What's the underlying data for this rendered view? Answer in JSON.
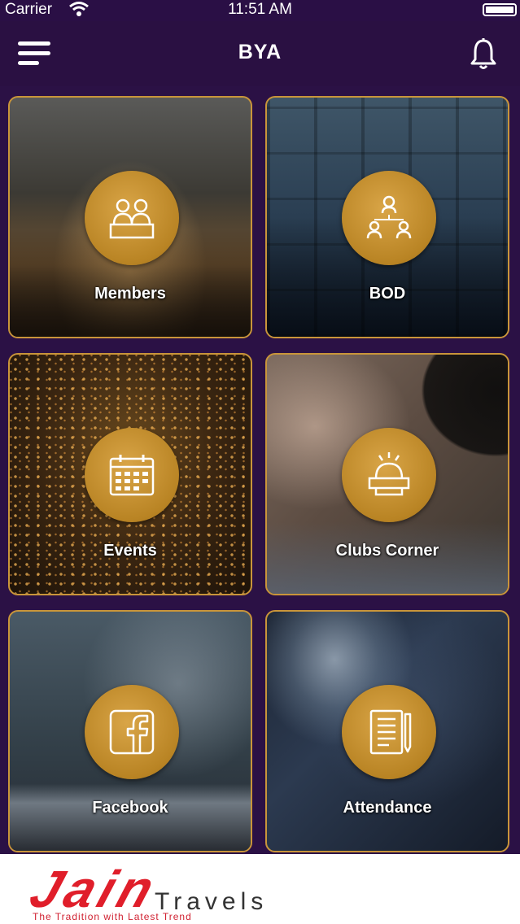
{
  "status_bar": {
    "carrier": "Carrier",
    "time": "11:51 AM"
  },
  "nav": {
    "title": "BYA"
  },
  "tiles": [
    {
      "label": "Members",
      "icon": "members-icon"
    },
    {
      "label": "BOD",
      "icon": "bod-icon"
    },
    {
      "label": "Events",
      "icon": "calendar-icon"
    },
    {
      "label": "Clubs Corner",
      "icon": "clubs-corner-icon"
    },
    {
      "label": "Facebook",
      "icon": "facebook-icon"
    },
    {
      "label": "Attendance",
      "icon": "attendance-icon"
    }
  ],
  "ad": {
    "brand": "Jain",
    "sub": "Travels",
    "tagline": "The Tradition with Latest Trend"
  },
  "colors": {
    "nav_bg": "#2a1042",
    "accent_gold": "#c9953a",
    "page_bg": "#2b1145"
  }
}
